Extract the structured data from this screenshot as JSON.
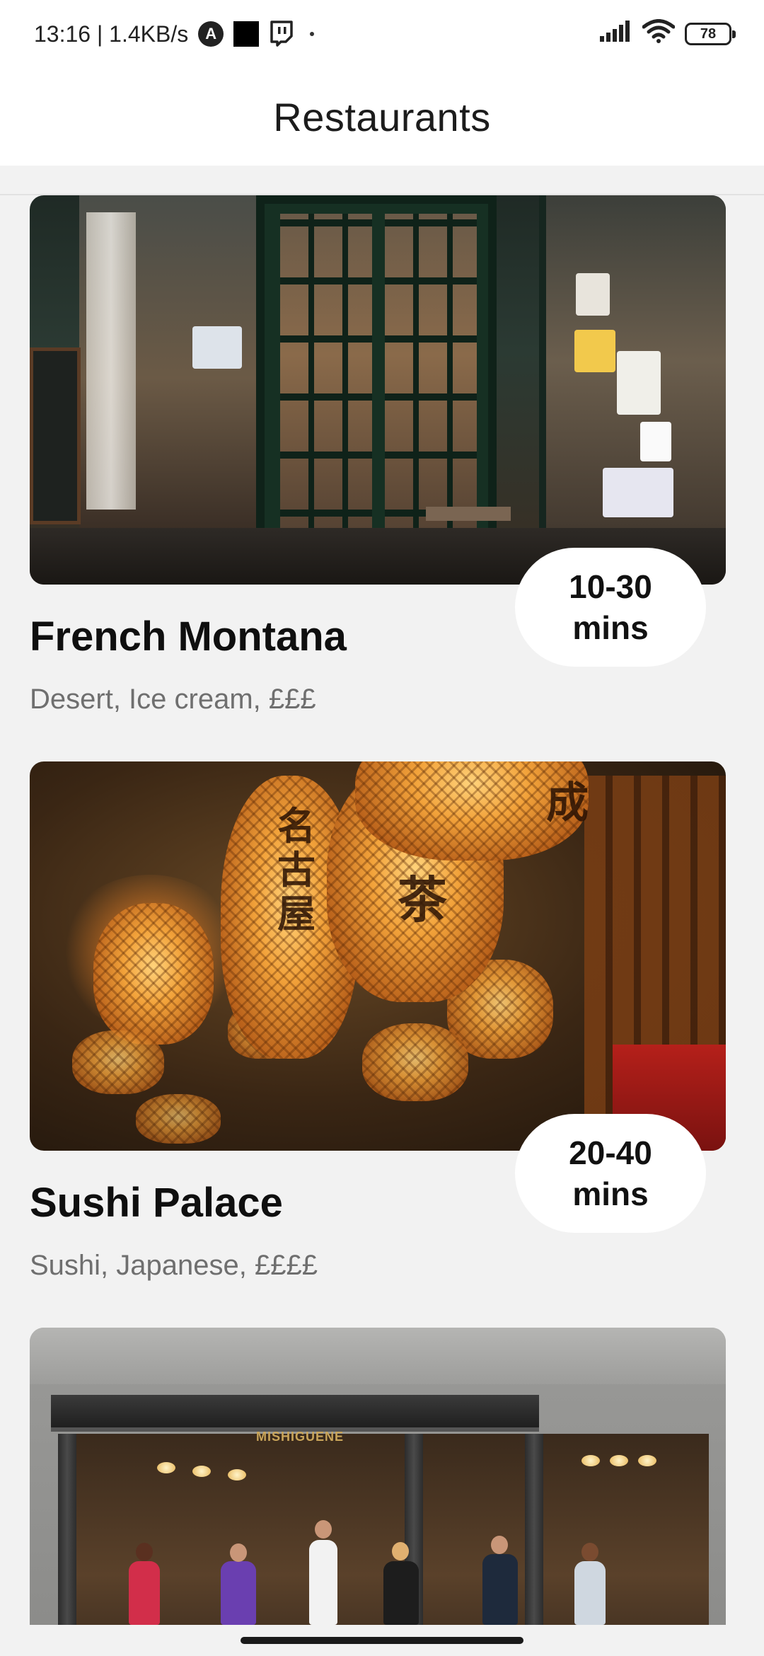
{
  "status_bar": {
    "time_speed": "13:16 | 1.4KB/s",
    "battery": "78",
    "icons": [
      "a-circle-icon",
      "black-square-icon",
      "twitch-icon",
      "dot-icon",
      "signal-icon",
      "wifi-icon",
      "battery-icon"
    ]
  },
  "app_bar": {
    "title": "Restaurants"
  },
  "restaurants": [
    {
      "name": "French Montana",
      "tags": "Desert, Ice cream, £££",
      "eta_line1": "10-30",
      "eta_line2": "mins"
    },
    {
      "name": "Sushi Palace",
      "tags": "Sushi, Japanese, ££££",
      "eta_line1": "20-40",
      "eta_line2": "mins"
    },
    {
      "sign": "MISHIGUENE"
    }
  ],
  "colors": {
    "background": "#f2f2f2",
    "surface": "#ffffff",
    "text_primary": "#111111",
    "text_secondary": "#6f6f6f"
  }
}
